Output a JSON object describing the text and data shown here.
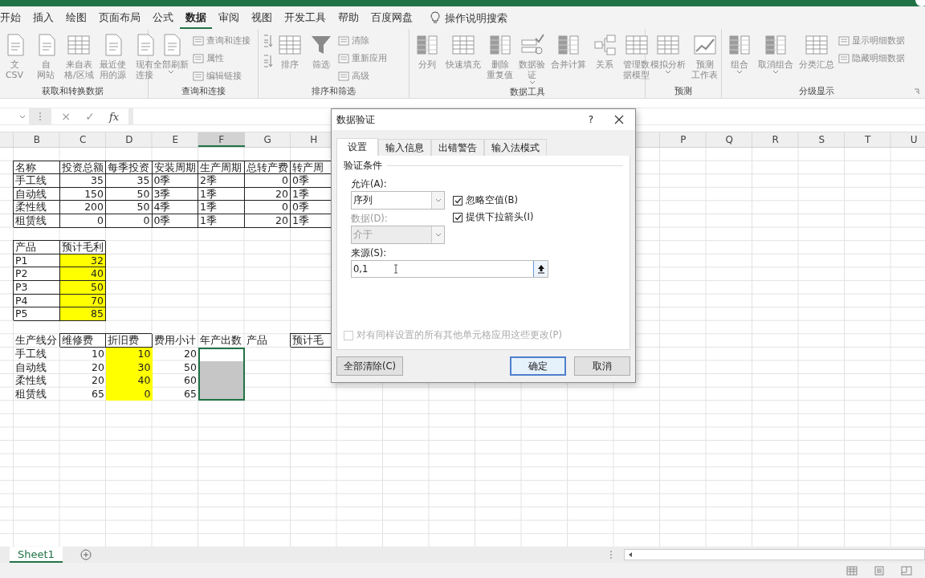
{
  "ribbon_tabs": [
    {
      "label": "开始",
      "selected": false
    },
    {
      "label": "插入",
      "selected": false
    },
    {
      "label": "绘图",
      "selected": false
    },
    {
      "label": "页面布局",
      "selected": false
    },
    {
      "label": "公式",
      "selected": false
    },
    {
      "label": "数据",
      "selected": true
    },
    {
      "label": "审阅",
      "selected": false
    },
    {
      "label": "视图",
      "selected": false
    },
    {
      "label": "开发工具",
      "selected": false
    },
    {
      "label": "帮助",
      "selected": false
    },
    {
      "label": "百度网盘",
      "selected": false
    }
  ],
  "tell_me": {
    "placeholder": "操作说明搜索"
  },
  "ribbon_groups": [
    {
      "label": "获取和转换数据",
      "controls": [
        {
          "kind": "large",
          "lines": [
            "文",
            "CSV"
          ],
          "menu": false
        },
        {
          "kind": "large",
          "lines": [
            "自",
            "网站"
          ],
          "menu": false
        },
        {
          "kind": "large",
          "lines": [
            "来自表",
            "格/区域"
          ],
          "menu": false
        },
        {
          "kind": "large",
          "lines": [
            "最近使",
            "用的源"
          ],
          "menu": false
        },
        {
          "kind": "large",
          "lines": [
            "现有",
            "连接"
          ],
          "menu": false
        }
      ]
    },
    {
      "label": "查询和连接",
      "controls": [
        {
          "kind": "large",
          "lines": [
            "全部刷新"
          ],
          "menu": true
        },
        {
          "kind": "stack",
          "items": [
            "查询和连接",
            "属性",
            "编辑链接"
          ]
        }
      ]
    },
    {
      "label": "排序和筛选",
      "controls": [
        {
          "kind": "sort-pair"
        },
        {
          "kind": "large",
          "lines": [
            "排序"
          ],
          "menu": false
        },
        {
          "kind": "large",
          "lines": [
            "筛选"
          ],
          "menu": false
        },
        {
          "kind": "stack",
          "items": [
            "清除",
            "重新应用",
            "高级"
          ]
        }
      ]
    },
    {
      "label": "数据工具",
      "controls": [
        {
          "kind": "large",
          "lines": [
            "分列"
          ],
          "menu": false
        },
        {
          "kind": "large",
          "lines": [
            "快速填充"
          ],
          "menu": false
        },
        {
          "kind": "large",
          "lines": [
            "删除",
            "重复值"
          ],
          "menu": false
        },
        {
          "kind": "large",
          "lines": [
            "数据验",
            "证"
          ],
          "menu": true
        },
        {
          "kind": "large",
          "lines": [
            "合并计算"
          ],
          "menu": false
        },
        {
          "kind": "large",
          "lines": [
            "关系"
          ],
          "menu": false
        },
        {
          "kind": "large",
          "lines": [
            "管理数",
            "据模型"
          ],
          "menu": false
        }
      ]
    },
    {
      "label": "预测",
      "controls": [
        {
          "kind": "large",
          "lines": [
            "模拟分析"
          ],
          "menu": true
        },
        {
          "kind": "large",
          "lines": [
            "预测",
            "工作表"
          ],
          "menu": false
        }
      ]
    },
    {
      "label": "分级显示",
      "controls": [
        {
          "kind": "large",
          "lines": [
            "组合"
          ],
          "menu": true
        },
        {
          "kind": "large",
          "lines": [
            "取消组合"
          ],
          "menu": true
        },
        {
          "kind": "large",
          "lines": [
            "分类汇总"
          ],
          "menu": false
        },
        {
          "kind": "stack",
          "items": [
            "显示明细数据",
            "隐藏明细数据"
          ]
        }
      ]
    }
  ],
  "formula_bar": {
    "buttons": [
      "×",
      "✓",
      "fx"
    ]
  },
  "columns": [
    {
      "label": "B",
      "selected": false
    },
    {
      "label": "C",
      "selected": false
    },
    {
      "label": "D",
      "selected": false
    },
    {
      "label": "E",
      "selected": false
    },
    {
      "label": "F",
      "selected": true
    },
    {
      "label": "G",
      "selected": false
    },
    {
      "label": "H",
      "selected": false
    },
    {
      "label": "P",
      "selected": false
    },
    {
      "label": "Q",
      "selected": false
    },
    {
      "label": "R",
      "selected": false
    },
    {
      "label": "S",
      "selected": false
    },
    {
      "label": "T",
      "selected": false
    },
    {
      "label": "U",
      "selected": false
    }
  ],
  "rows": [
    {
      "kind": "blank"
    },
    {
      "kind": "data",
      "cells": [
        {
          "text": "名称",
          "kind": "text",
          "border": true,
          "selected": false
        },
        {
          "text": "投资总额",
          "kind": "text",
          "border": true,
          "selected": false
        },
        {
          "text": "每季投资",
          "kind": "text",
          "border": true,
          "selected": false
        },
        {
          "text": "安装周期",
          "kind": "text",
          "border": true,
          "selected": false
        },
        {
          "text": "生产周期",
          "kind": "text",
          "border": true,
          "selected": false
        },
        {
          "text": "总转产费",
          "kind": "text",
          "border": true,
          "selected": false
        },
        {
          "text": "转产周",
          "kind": "text",
          "border": true,
          "selected": false
        }
      ]
    },
    {
      "kind": "data",
      "cells": [
        {
          "text": "手工线",
          "kind": "text",
          "border": true,
          "selected": false
        },
        {
          "text": "35",
          "kind": "number",
          "border": true,
          "selected": false
        },
        {
          "text": "35",
          "kind": "number",
          "border": true,
          "selected": false
        },
        {
          "text": "0季",
          "kind": "text",
          "border": true,
          "selected": false
        },
        {
          "text": "2季",
          "kind": "text",
          "border": true,
          "selected": false
        },
        {
          "text": "0",
          "kind": "number",
          "border": true,
          "selected": false
        },
        {
          "text": "0季",
          "kind": "text",
          "border": true,
          "selected": false
        }
      ]
    },
    {
      "kind": "data",
      "cells": [
        {
          "text": "自动线",
          "kind": "text",
          "border": true,
          "selected": false
        },
        {
          "text": "150",
          "kind": "number",
          "border": true,
          "selected": false
        },
        {
          "text": "50",
          "kind": "number",
          "border": true,
          "selected": false
        },
        {
          "text": "3季",
          "kind": "text",
          "border": true,
          "selected": false
        },
        {
          "text": "1季",
          "kind": "text",
          "border": true,
          "selected": false
        },
        {
          "text": "20",
          "kind": "number",
          "border": true,
          "selected": false
        },
        {
          "text": "1季",
          "kind": "text",
          "border": true,
          "selected": false
        }
      ]
    },
    {
      "kind": "data",
      "cells": [
        {
          "text": "柔性线",
          "kind": "text",
          "border": true,
          "selected": false
        },
        {
          "text": "200",
          "kind": "number",
          "border": true,
          "selected": false
        },
        {
          "text": "50",
          "kind": "number",
          "border": true,
          "selected": false
        },
        {
          "text": "4季",
          "kind": "text",
          "border": true,
          "selected": false
        },
        {
          "text": "1季",
          "kind": "text",
          "border": true,
          "selected": false
        },
        {
          "text": "0",
          "kind": "number",
          "border": true,
          "selected": false
        },
        {
          "text": "0季",
          "kind": "text",
          "border": true,
          "selected": false
        }
      ]
    },
    {
      "kind": "data",
      "cells": [
        {
          "text": "租赁线",
          "kind": "text",
          "border": true,
          "selected": false
        },
        {
          "text": "0",
          "kind": "number",
          "border": true,
          "selected": false
        },
        {
          "text": "0",
          "kind": "number",
          "border": true,
          "selected": false
        },
        {
          "text": "0季",
          "kind": "text",
          "border": true,
          "selected": false
        },
        {
          "text": "1季",
          "kind": "text",
          "border": true,
          "selected": false
        },
        {
          "text": "20",
          "kind": "number",
          "border": true,
          "selected": false
        },
        {
          "text": "1季",
          "kind": "text",
          "border": true,
          "selected": false
        }
      ]
    },
    {
      "kind": "blank"
    },
    {
      "kind": "data",
      "cells": [
        {
          "text": "产品",
          "kind": "text",
          "border": true,
          "selected": false
        },
        {
          "text": "预计毛利",
          "kind": "text",
          "border": true,
          "selected": false
        }
      ]
    },
    {
      "kind": "data",
      "cells": [
        {
          "text": "P1",
          "kind": "text",
          "border": true,
          "selected": false
        },
        {
          "text": "32",
          "kind": "number",
          "border": true,
          "selected": false,
          "color": "#ffff00"
        }
      ]
    },
    {
      "kind": "data",
      "cells": [
        {
          "text": "P2",
          "kind": "text",
          "border": true,
          "selected": false
        },
        {
          "text": "40",
          "kind": "number",
          "border": true,
          "selected": false,
          "color": "#ffff00"
        }
      ]
    },
    {
      "kind": "data",
      "cells": [
        {
          "text": "P3",
          "kind": "text",
          "border": true,
          "selected": false
        },
        {
          "text": "50",
          "kind": "number",
          "border": true,
          "selected": false,
          "color": "#ffff00"
        }
      ]
    },
    {
      "kind": "data",
      "cells": [
        {
          "text": "P4",
          "kind": "text",
          "border": true,
          "selected": false
        },
        {
          "text": "70",
          "kind": "number",
          "border": true,
          "selected": false,
          "color": "#ffff00"
        }
      ]
    },
    {
      "kind": "data",
      "cells": [
        {
          "text": "P5",
          "kind": "text",
          "border": true,
          "selected": false
        },
        {
          "text": "85",
          "kind": "number",
          "border": true,
          "selected": false,
          "color": "#ffff00"
        }
      ]
    },
    {
      "kind": "blank"
    },
    {
      "kind": "data",
      "cells": [
        {
          "text": "生产线分",
          "kind": "text",
          "border": false,
          "selected": false
        },
        {
          "text": "维修费",
          "kind": "text",
          "border": true,
          "selected": false
        },
        {
          "text": "折旧费",
          "kind": "text",
          "border": true,
          "selected": false
        },
        {
          "text": "费用小计",
          "kind": "text",
          "border": false,
          "selected": false
        },
        {
          "text": "年产出数",
          "kind": "text",
          "border": false,
          "selected": false
        },
        {
          "text": "产品",
          "kind": "text",
          "border": false,
          "selected": false
        },
        {
          "text": "预计毛",
          "kind": "text",
          "border": true,
          "selected": false
        }
      ]
    },
    {
      "kind": "data",
      "cells": [
        {
          "text": "手工线",
          "kind": "text",
          "border": false,
          "selected": false
        },
        {
          "text": "10",
          "kind": "number",
          "border": false,
          "selected": false
        },
        {
          "text": "10",
          "kind": "number",
          "border": false,
          "selected": false,
          "color": "#ffff00"
        },
        {
          "text": "20",
          "kind": "number",
          "border": false,
          "selected": false
        },
        {
          "border": false,
          "selected": true
        }
      ]
    },
    {
      "kind": "data",
      "cells": [
        {
          "text": "自动线",
          "kind": "text",
          "border": false,
          "selected": false
        },
        {
          "text": "20",
          "kind": "number",
          "border": false,
          "selected": false
        },
        {
          "text": "30",
          "kind": "number",
          "border": false,
          "selected": false,
          "color": "#ffff00"
        },
        {
          "text": "50",
          "kind": "number",
          "border": false,
          "selected": false
        },
        {
          "border": false,
          "selected": true
        }
      ]
    },
    {
      "kind": "data",
      "cells": [
        {
          "text": "柔性线",
          "kind": "text",
          "border": false,
          "selected": false
        },
        {
          "text": "20",
          "kind": "number",
          "border": false,
          "selected": false
        },
        {
          "text": "40",
          "kind": "number",
          "border": false,
          "selected": false,
          "color": "#ffff00"
        },
        {
          "text": "60",
          "kind": "number",
          "border": false,
          "selected": false
        },
        {
          "border": false,
          "selected": true
        }
      ]
    },
    {
      "kind": "data",
      "cells": [
        {
          "text": "租赁线",
          "kind": "text",
          "border": false,
          "selected": false
        },
        {
          "text": "65",
          "kind": "number",
          "border": false,
          "selected": false
        },
        {
          "text": "0",
          "kind": "number",
          "border": false,
          "selected": false,
          "color": "#ffff00"
        },
        {
          "text": "65",
          "kind": "number",
          "border": false,
          "selected": false
        },
        {
          "border": false,
          "selected": true
        }
      ]
    }
  ],
  "sheet_tabs": [
    {
      "label": "Sheet1",
      "selected": true
    }
  ],
  "dialog": {
    "title": "数据验证",
    "help": "?",
    "tabs": [
      {
        "label": "设置",
        "selected": true
      },
      {
        "label": "输入信息",
        "selected": false
      },
      {
        "label": "出错警告",
        "selected": false
      },
      {
        "label": "输入法模式",
        "selected": false
      }
    ],
    "section": "验证条件",
    "allow": {
      "label": "允许(A):",
      "value": "序列",
      "disabled": false
    },
    "data": {
      "label": "数据(D):",
      "value": "介于",
      "disabled": true
    },
    "checkboxes": [
      {
        "label": "忽略空值(B)",
        "checked": true,
        "disabled": false
      },
      {
        "label": "提供下拉箭头(I)",
        "checked": true,
        "disabled": false
      }
    ],
    "source": {
      "label": "来源(S):",
      "value": "0,1"
    },
    "apply_all": {
      "label": "对有同样设置的所有其他单元格应用这些更改(P)",
      "checked": false,
      "disabled": true
    },
    "buttons": [
      {
        "label": "全部清除(C)",
        "default": false
      },
      {
        "label": "确定",
        "default": true
      },
      {
        "label": "取消",
        "default": false
      }
    ]
  }
}
